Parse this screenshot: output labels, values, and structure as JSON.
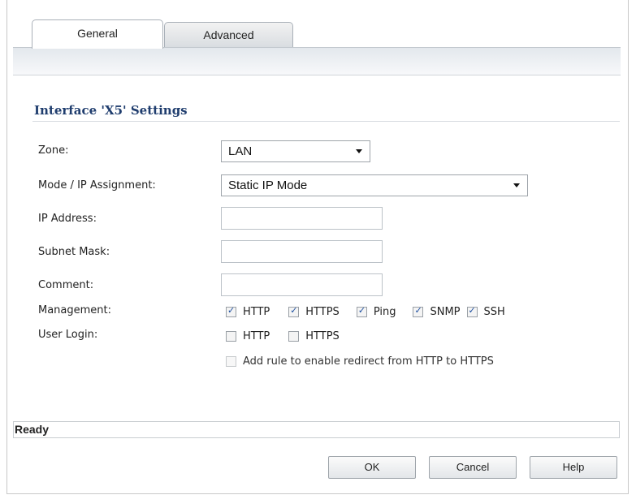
{
  "tabs": [
    {
      "label": "General",
      "active": true
    },
    {
      "label": "Advanced",
      "active": false
    }
  ],
  "section_title": "Interface 'X5' Settings",
  "fields": {
    "zone": {
      "label": "Zone:",
      "value": "LAN"
    },
    "mode": {
      "label": "Mode / IP Assignment:",
      "value": "Static IP Mode"
    },
    "ip_address": {
      "label": "IP Address:",
      "value": ""
    },
    "subnet_mask": {
      "label": "Subnet Mask:",
      "value": ""
    },
    "comment": {
      "label": "Comment:",
      "value": ""
    }
  },
  "management": {
    "label": "Management:",
    "options": [
      {
        "label": "HTTP",
        "checked": true
      },
      {
        "label": "HTTPS",
        "checked": true
      },
      {
        "label": "Ping",
        "checked": true
      },
      {
        "label": "SNMP",
        "checked": true
      },
      {
        "label": "SSH",
        "checked": true
      }
    ]
  },
  "user_login": {
    "label": "User Login:",
    "options": [
      {
        "label": "HTTP",
        "checked": false
      },
      {
        "label": "HTTPS",
        "checked": false
      }
    ]
  },
  "redirect": {
    "label": "Add rule to enable redirect from HTTP to HTTPS",
    "checked": false,
    "enabled": false
  },
  "status": "Ready",
  "buttons": {
    "ok": "OK",
    "cancel": "Cancel",
    "help": "Help"
  },
  "colors": {
    "section_title": "#1f3d6e",
    "check": "#1d4fa0"
  }
}
